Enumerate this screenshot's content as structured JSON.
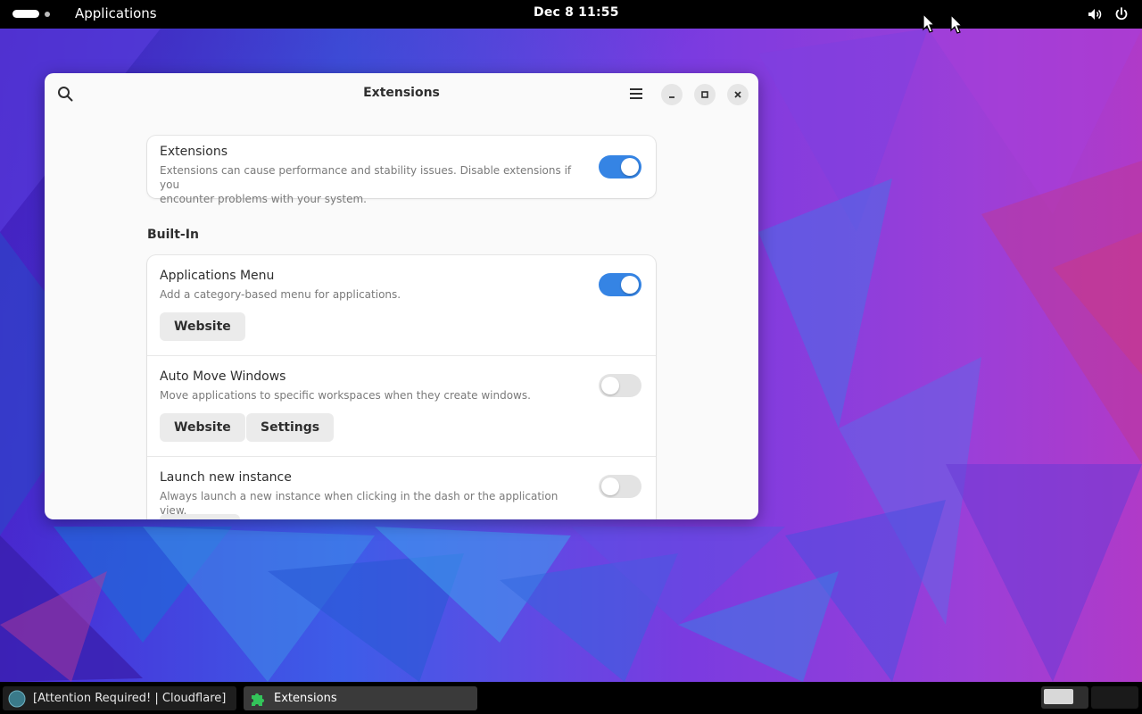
{
  "topbar": {
    "activities_label": "Applications",
    "clock": "Dec 8  11:55",
    "tray_icons": [
      "volume-icon",
      "power-icon"
    ]
  },
  "window": {
    "title": "Extensions",
    "main_card": {
      "title": "Extensions",
      "description_line1": "Extensions can cause performance and stability issues. Disable extensions if you",
      "description_line2": "encounter problems with your system.",
      "enabled": true
    },
    "section_title": "Built-In",
    "extensions": [
      {
        "name": "Applications Menu",
        "description": "Add a category-based menu for applications.",
        "enabled": true,
        "buttons": [
          "Website"
        ]
      },
      {
        "name": "Auto Move Windows",
        "description": "Move applications to specific workspaces when they create windows.",
        "enabled": false,
        "buttons": [
          "Website",
          "Settings"
        ]
      },
      {
        "name": "Launch new instance",
        "description": "Always launch a new instance when clicking in the dash or the application view.",
        "enabled": false,
        "buttons": []
      }
    ]
  },
  "taskbar": {
    "tasks": [
      {
        "label": "[Attention Required! | Cloudflare]"
      },
      {
        "label": "Extensions"
      }
    ]
  },
  "colors": {
    "accent": "#3584e4",
    "topbar": "#000000",
    "window_bg": "#fafafa"
  }
}
